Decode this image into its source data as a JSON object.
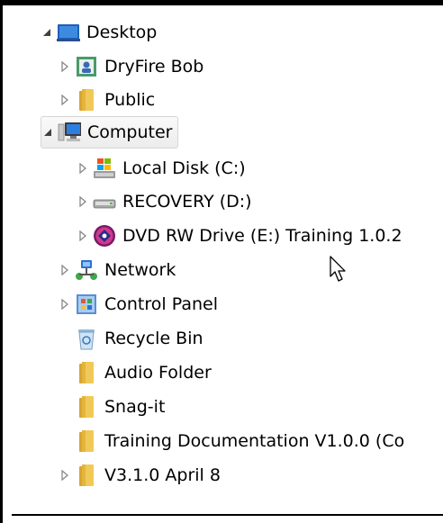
{
  "tree": {
    "desktop": {
      "label": "Desktop",
      "expanded": true,
      "icon": "desktop-icon"
    },
    "dryfire_bob": {
      "label": "DryFire Bob",
      "expanded": false,
      "icon": "user-folder-icon"
    },
    "public": {
      "label": "Public",
      "expanded": false,
      "icon": "folder-icon"
    },
    "computer": {
      "label": "Computer",
      "expanded": true,
      "selected": true,
      "icon": "computer-icon"
    },
    "local_disk": {
      "label": "Local Disk (C:)",
      "expanded": false,
      "icon": "windows-drive-icon"
    },
    "recovery": {
      "label": "RECOVERY (D:)",
      "expanded": false,
      "icon": "hard-drive-icon"
    },
    "dvd": {
      "label": "DVD RW Drive (E:) Training 1.0.2",
      "expanded": false,
      "icon": "dvd-disc-icon"
    },
    "network": {
      "label": "Network",
      "expanded": false,
      "icon": "network-icon"
    },
    "control_panel": {
      "label": "Control Panel",
      "expanded": false,
      "icon": "control-panel-icon"
    },
    "recycle_bin": {
      "label": "Recycle Bin",
      "icon": "recycle-bin-icon"
    },
    "audio_folder": {
      "label": "Audio Folder",
      "icon": "folder-icon"
    },
    "snagit": {
      "label": "Snag-it",
      "icon": "folder-icon"
    },
    "training_docs": {
      "label": "Training Documentation V1.0.0 (Co",
      "icon": "folder-icon"
    },
    "v310": {
      "label": "V3.1.0 April 8",
      "expanded": false,
      "icon": "folder-icon"
    }
  },
  "colors": {
    "folder": "#e8b83a",
    "selection_border": "#d6d6d6",
    "frame": "#000000"
  }
}
